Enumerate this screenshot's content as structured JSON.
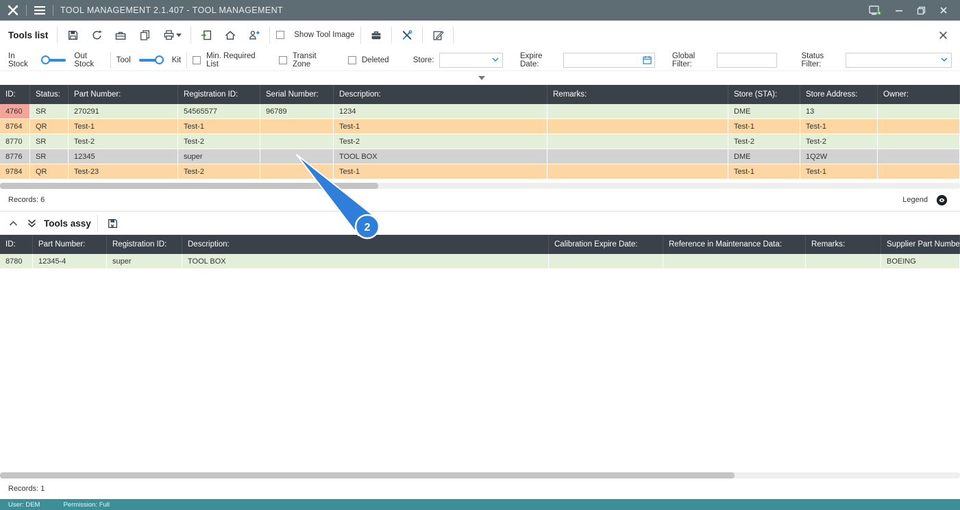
{
  "titlebar": {
    "title": "TOOL MANAGEMENT 2.1.407 - TOOL MANAGEMENT"
  },
  "toolbar": {
    "title": "Tools list",
    "show_tool_image": "Show Tool Image"
  },
  "filters": {
    "in_stock": "In Stock",
    "out_stock": "Out Stock",
    "tool": "Tool",
    "kit": "Kit",
    "min_required": "Min. Required List",
    "transit": "Transit Zone",
    "deleted": "Deleted",
    "store_label": "Store:",
    "expire_label": "Expire Date:",
    "global_label": "Global Filter:",
    "status_label": "Status Filter:"
  },
  "tools_table": {
    "columns": [
      "ID:",
      "Status:",
      "Part Number:",
      "Registration ID:",
      "Serial Number:",
      "Description:",
      "Remarks:",
      "Store (STA):",
      "Store Address:",
      "Owner:"
    ],
    "rows": [
      [
        "4760",
        "SR",
        "270291",
        "54565577",
        "96789",
        "1234",
        "",
        "DME",
        "13",
        ""
      ],
      [
        "8764",
        "QR",
        "Test-1",
        "Test-1",
        "",
        "Test-1",
        "",
        "Test-1",
        "Test-1",
        ""
      ],
      [
        "8770",
        "SR",
        "Test-2",
        "Test-2",
        "",
        "Test-2",
        "",
        "Test-2",
        "Test-2",
        ""
      ],
      [
        "8776",
        "SR",
        "12345",
        "super",
        "",
        "TOOL BOX",
        "",
        "DME",
        "1Q2W",
        ""
      ],
      [
        "9784",
        "QR",
        "Test-23",
        "Test-2",
        "",
        "Test-1",
        "",
        "Test-1",
        "Test-1",
        ""
      ]
    ],
    "records": "Records: 6",
    "legend": "Legend"
  },
  "assy": {
    "title": "Tools assy",
    "columns": [
      "ID:",
      "Part Number:",
      "Registration ID:",
      "Description:",
      "Calibration Expire Date:",
      "Reference in Maintenance Data:",
      "Remarks:",
      "Supplier Part Number"
    ],
    "rows": [
      [
        "8780",
        "12345-4",
        "super",
        "TOOL BOX",
        "",
        "",
        "",
        "BOEING"
      ]
    ],
    "records": "Records: 1"
  },
  "statusbar": {
    "user": "User: DEM",
    "permission": "Permission: Full"
  },
  "annotation": {
    "step": "2"
  },
  "colors": {
    "accent_blue": "#2e7fd9",
    "row_green": "#e3efd9",
    "row_orange": "#fcd7a4",
    "row_selected": "#d2d2d2",
    "id_alert": "#f2a69b",
    "header_dark": "#3a4149",
    "footer_teal": "#3e8e99",
    "titlebar_gray": "#5e6c74"
  }
}
